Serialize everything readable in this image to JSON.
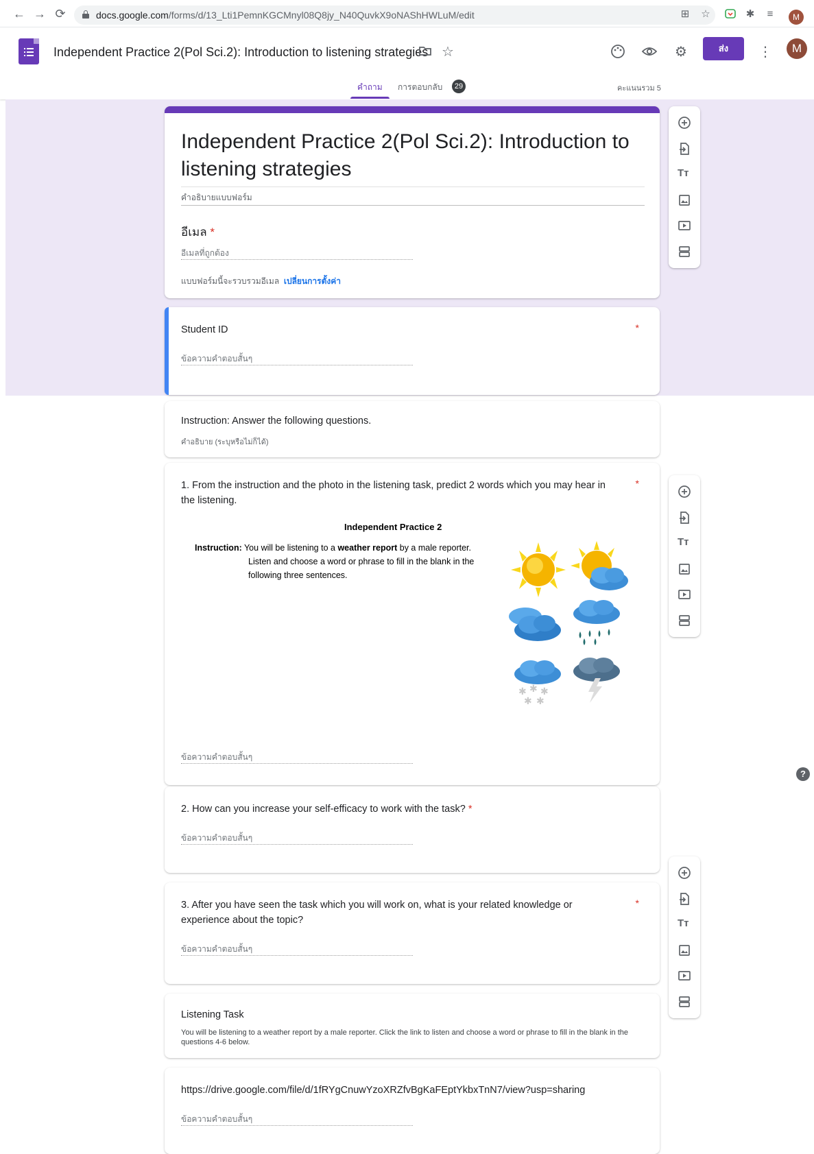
{
  "browser": {
    "url_host": "docs.google.com",
    "url_path": "/forms/d/13_Lti1PemnKGCMnyl08Q8jy_N40QuvkX9oNAShHWLuM/edit",
    "profile_initial": "M"
  },
  "header": {
    "doc_title": "Independent Practice 2(Pol Sci.2): Introduction to listening strategies",
    "send_label": "ส่ง",
    "avatar_initial": "M",
    "tabs": [
      {
        "label": "คำถาม"
      },
      {
        "label": "การตอบกลับ"
      }
    ],
    "responses_count": "29",
    "total_points": "คะแนนรวม 5"
  },
  "form": {
    "title": "Independent Practice 2(Pol Sci.2): Introduction to listening strategies",
    "description_placeholder": "คำอธิบายแบบฟอร์ม",
    "email_label": "อีเมล",
    "required_mark": "*",
    "email_placeholder": "อีเมลที่ถูกต้อง",
    "collect_note": "แบบฟอร์มนี้จะรวบรวมอีเมล",
    "collect_link": "เปลี่ยนการตั้งค่า"
  },
  "questions": [
    {
      "title": "Student ID",
      "placeholder": "ข้อความคำตอบสั้นๆ"
    },
    {
      "title": "Instruction: Answer the following questions.",
      "description": "คำอธิบาย (ระบุหรือไม่ก็ได้)"
    },
    {
      "title": "1. From the instruction  and the photo in the listening task, predict 2 words which you may hear in the listening.",
      "placeholder": "ข้อความคำตอบสั้นๆ"
    },
    {
      "title": "2. How can you increase your self-efficacy to work with the task?",
      "placeholder": "ข้อความคำตอบสั้นๆ"
    },
    {
      "title": "3. After you have seen the task which you will work on, what is your related knowledge or experience about the topic?",
      "placeholder": "ข้อความคำตอบสั้นๆ"
    },
    {
      "title": "Listening Task",
      "description": "You will be listening to a weather report by a male reporter. Click the link to listen and choose a word or phrase to fill in the blank in the questions 4-6 below."
    },
    {
      "title": "https://drive.google.com/file/d/1fRYgCnuwYzoXRZfvBgKaFEptYkbxTnN7/view?usp=sharing",
      "placeholder": "ข้อความคำตอบสั้นๆ"
    }
  ],
  "embedded_image": {
    "heading": "Independent Practice 2",
    "instruction_label": "Instruction:",
    "instruction_pre": " You will be listening to a ",
    "instruction_bold": "weather report",
    "instruction_post": " by a male reporter.",
    "line2": "Listen and choose a word or phrase to fill in the blank in the",
    "line3": "following three sentences.",
    "icons": [
      "sunny-icon",
      "partly-cloudy-icon",
      "cloudy-icon",
      "rain-icon",
      "snow-icon",
      "thunderstorm-icon"
    ]
  },
  "colors": {
    "brand_purple": "#673ab7",
    "canvas_lavender": "#ede7f6",
    "selected_blue": "#4285f4",
    "required_red": "#d93025",
    "link_blue": "#1a73e8"
  }
}
